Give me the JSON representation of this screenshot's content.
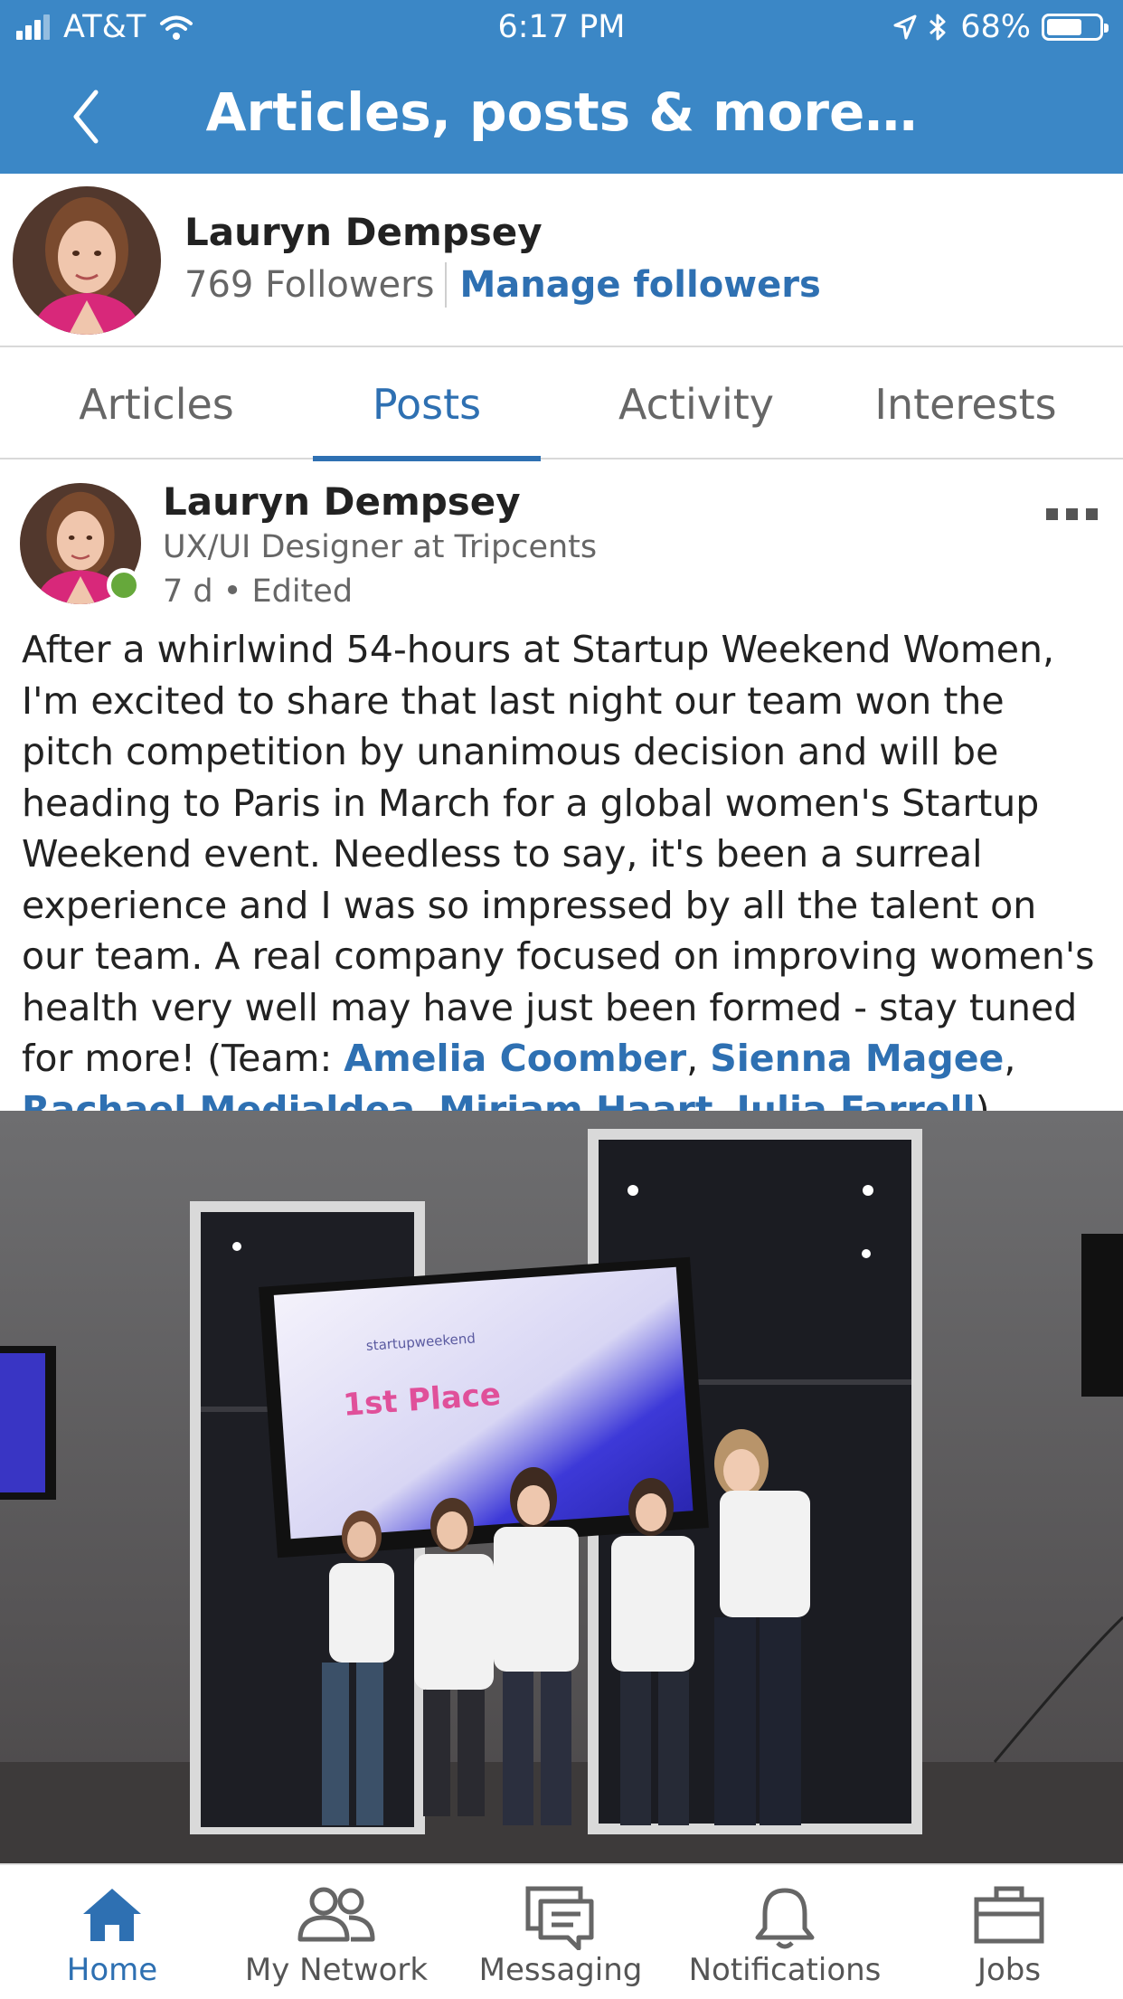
{
  "status_bar": {
    "carrier": "AT&T",
    "time": "6:17 PM",
    "battery": "68%",
    "battery_level": 0.68
  },
  "nav": {
    "title": "Articles, posts & more…"
  },
  "profile": {
    "name": "Lauryn Dempsey",
    "followers": "769 Followers",
    "manage_label": "Manage followers"
  },
  "tabs": [
    {
      "label": "Articles",
      "active": false
    },
    {
      "label": "Posts",
      "active": true
    },
    {
      "label": "Activity",
      "active": false
    },
    {
      "label": "Interests",
      "active": false
    }
  ],
  "post": {
    "author": "Lauryn Dempsey",
    "headline": "UX/UI Designer at Tripcents",
    "meta": "7 d • Edited",
    "body": "After a whirlwind 54-hours at Startup Weekend Women, I'm excited to share that last night our team won the pitch competition by unanimous decision and will be heading to Paris in March for a global women's Startup Weekend event. Needless to say, it's been a surreal experience and I was so impressed by all the talent on our team. A real company focused on improving women's health very well may have just been formed - stay tuned for more! (Team: ",
    "mentions": [
      "Amelia Coomber",
      "Sienna Magee",
      "Rachael Medialdea",
      "Miriam Haart",
      "Julia Farrell"
    ],
    "separator": ", ",
    "closing": ")",
    "photo": {
      "screen_brand": "startupweekend",
      "screen_text": "1st Place"
    }
  },
  "bottom_nav": [
    {
      "label": "Home",
      "icon": "home-icon",
      "active": true
    },
    {
      "label": "My Network",
      "icon": "network-icon",
      "active": false
    },
    {
      "label": "Messaging",
      "icon": "messaging-icon",
      "active": false
    },
    {
      "label": "Notifications",
      "icon": "bell-icon",
      "active": false
    },
    {
      "label": "Jobs",
      "icon": "briefcase-icon",
      "active": false
    }
  ],
  "colors": {
    "brand_blue": "#3b87c6",
    "link_blue": "#2e70b2",
    "online_green": "#66a83b"
  }
}
